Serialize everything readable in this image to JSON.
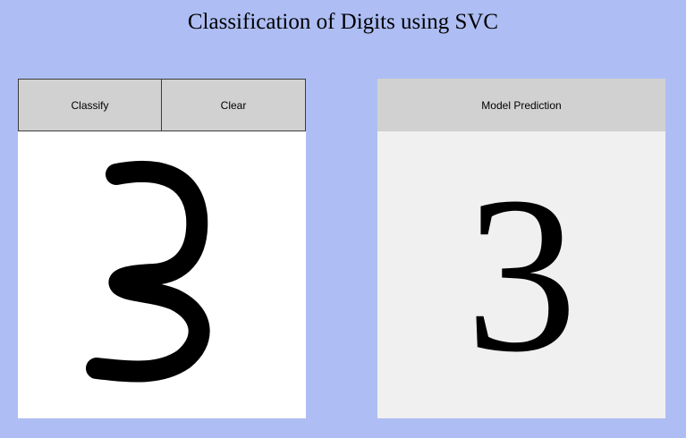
{
  "app": {
    "title": "Classification of Digits using SVC"
  },
  "toolbar": {
    "classify_label": "Classify",
    "clear_label": "Clear"
  },
  "canvas": {
    "drawn_digit": "3"
  },
  "result": {
    "header_label": "Model Prediction",
    "predicted_digit": "3"
  }
}
